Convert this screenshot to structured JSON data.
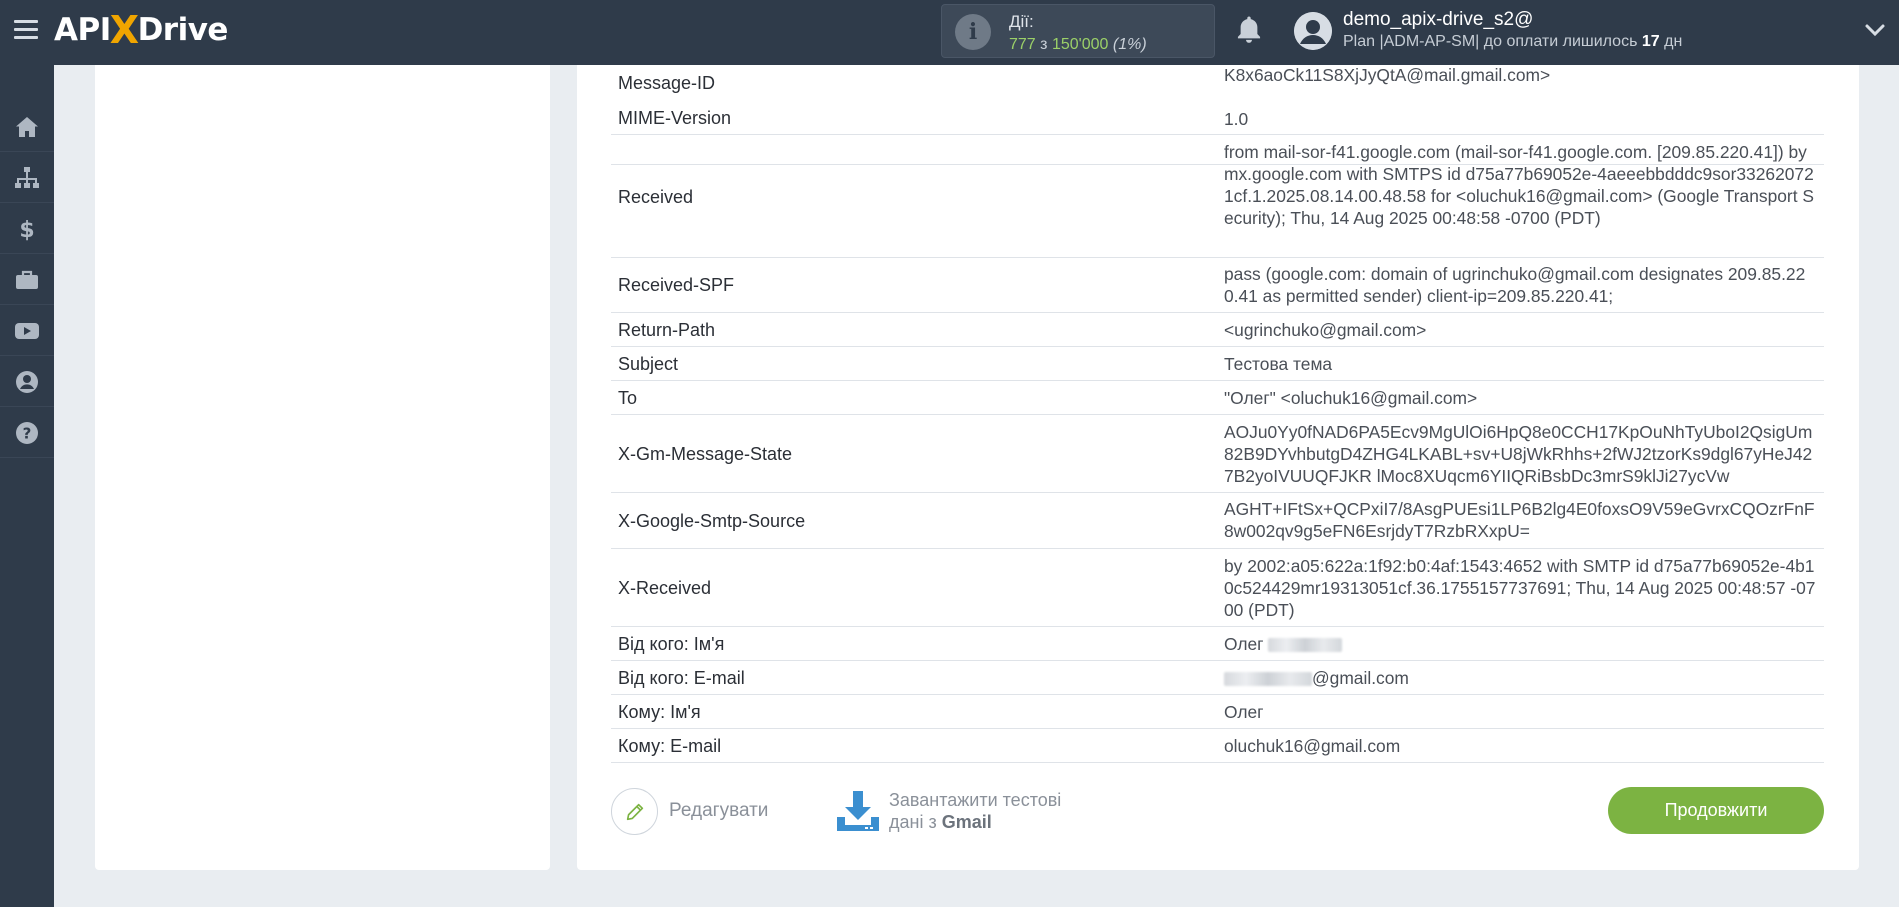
{
  "header": {
    "logo_left": "API",
    "logo_x": "X",
    "logo_right": "Drive",
    "actions_label": "Дії:",
    "actions_used": "777",
    "actions_of": "з",
    "actions_total": "150'000",
    "actions_pct": "(1%)",
    "user_name": "demo_apix-drive_s2@",
    "plan_prefix": "Plan |ADM-AP-SM| до оплати лишилось",
    "plan_days": "17",
    "plan_suffix": "дн"
  },
  "sidebar": {
    "items": [
      {
        "icon": "home-icon"
      },
      {
        "icon": "sitemap-icon"
      },
      {
        "icon": "dollar-icon"
      },
      {
        "icon": "briefcase-icon"
      },
      {
        "icon": "video-icon"
      },
      {
        "icon": "user-icon"
      },
      {
        "icon": "help-icon"
      }
    ]
  },
  "table": {
    "rows": [
      {
        "key": "Message-ID",
        "value": "K8x6aoCk11S8XjJyQtA@mail.gmail.com>"
      },
      {
        "key": "MIME-Version",
        "value": "1.0"
      },
      {
        "key": "Received",
        "value": "from mail-sor-f41.google.com (mail-sor-f41.google.com. [209.85.220.41]) by mx.google.com with SMTPS id d75a77b69052e-4aeeebbdddc9sor332620721cf.1.2025.08.14.00.48.58 for <oluchuk16@gmail.com> (Google Transport Security); Thu, 14 Aug 2025 00:48:58 -0700 (PDT)"
      },
      {
        "key": "Received-SPF",
        "value": "pass (google.com: domain of ugrinchuko@gmail.com designates 209.85.220.41 as permitted sender) client-ip=209.85.220.41;"
      },
      {
        "key": "Return-Path",
        "value": "<ugrinchuko@gmail.com>"
      },
      {
        "key": "Subject",
        "value": "Тестова тема"
      },
      {
        "key": "To",
        "value": "\"Олег\" <oluchuk16@gmail.com>"
      },
      {
        "key": "X-Gm-Message-State",
        "value": "AOJu0Yy0fNAD6PA5Ecv9MgUlOi6HpQ8e0CCH17KpOuNhTyUboI2QsigUm82B9DYvhbutgD4ZHG4LKABL+sv+U8jWkRhhs+2fWJ2tzorKs9dgl67yHeJ427B2yoIVUUQFJKR lMoc8XUqcm6YIIQRiBsbDc3mrS9klJi27ycVw"
      },
      {
        "key": "X-Google-Smtp-Source",
        "value": "AGHT+IFtSx+QCPxiI7/8AsgPUEsi1LP6B2lg4E0foxsO9V59eGvrxCQOzrFnF8w002qv9g5eFN6EsrjdyT7RzbRXxpU="
      },
      {
        "key": "X-Received",
        "value": "by 2002:a05:622a:1f92:b0:4af:1543:4652 with SMTP id d75a77b69052e-4b10c524429mr19313051cf.36.1755157737691; Thu, 14 Aug 2025 00:48:57 -0700 (PDT)"
      },
      {
        "key": "Від кого: Ім'я",
        "value": "Олег"
      },
      {
        "key": "Від кого: E-mail",
        "value": "@gmail.com"
      },
      {
        "key": "Кому: Ім'я",
        "value": "Олег"
      },
      {
        "key": "Кому: E-mail",
        "value": "oluchuk16@gmail.com"
      }
    ]
  },
  "footer": {
    "edit_label": "Редагувати",
    "download_line1": "Завантажити тестові",
    "download_line2_prefix": "дані з",
    "download_line2_bold": "Gmail",
    "continue_label": "Продовжити"
  },
  "colors": {
    "topbar": "#2f3b4a",
    "accent_green": "#7cb342",
    "logo_x": "#f0a500",
    "download_blue": "#3b8fd0"
  }
}
